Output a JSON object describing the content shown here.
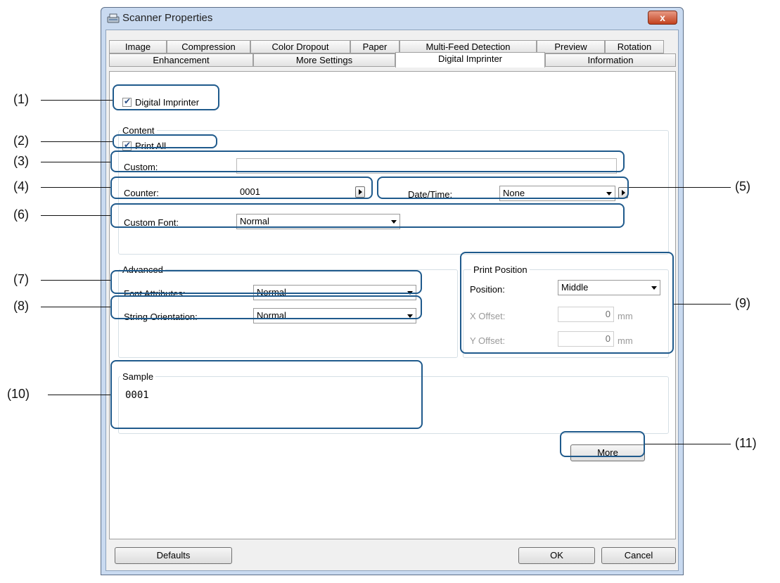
{
  "window": {
    "title": "Scanner Properties",
    "close_glyph": "x"
  },
  "tabs_row1": [
    "Image",
    "Compression",
    "Color Dropout",
    "Paper",
    "Multi-Feed Detection",
    "Preview",
    "Rotation"
  ],
  "tabs_row2": [
    "Enhancement",
    "More Settings",
    "Digital Imprinter",
    "Information"
  ],
  "active_tab": "Digital Imprinter",
  "digital_imprinter": {
    "enable_label": "Digital Imprinter",
    "enable_checked": true
  },
  "content": {
    "group_title": "Content",
    "print_all_label": "Print All",
    "print_all_checked": true,
    "custom_label": "Custom:",
    "custom_value": "",
    "counter_label": "Counter:",
    "counter_value": "0001",
    "datetime_label": "Date/Time:",
    "datetime_value": "None",
    "custom_font_label": "Custom Font:",
    "custom_font_value": "Normal"
  },
  "advanced": {
    "group_title": "Advanced",
    "font_attributes_label": "Font Attributes:",
    "font_attributes_value": "Normal",
    "string_orientation_label": "String Orientation:",
    "string_orientation_value": "Normal"
  },
  "print_position": {
    "group_title": "Print Position",
    "position_label": "Position:",
    "position_value": "Middle",
    "x_offset_label": "X Offset:",
    "x_offset_value": "0",
    "y_offset_label": "Y Offset:",
    "y_offset_value": "0",
    "unit": "mm"
  },
  "sample": {
    "group_title": "Sample",
    "text": "0001"
  },
  "buttons": {
    "more": "More",
    "defaults": "Defaults",
    "ok": "OK",
    "cancel": "Cancel"
  },
  "callouts": [
    "(1)",
    "(2)",
    "(3)",
    "(4)",
    "(5)",
    "(6)",
    "(7)",
    "(8)",
    "(9)",
    "(10)",
    "(11)"
  ],
  "colors": {
    "callout_ring": "#1f5a8c",
    "window_frame": "#c9daf0",
    "close_button": "#c3421f",
    "check_mark": "#2b4e85"
  }
}
